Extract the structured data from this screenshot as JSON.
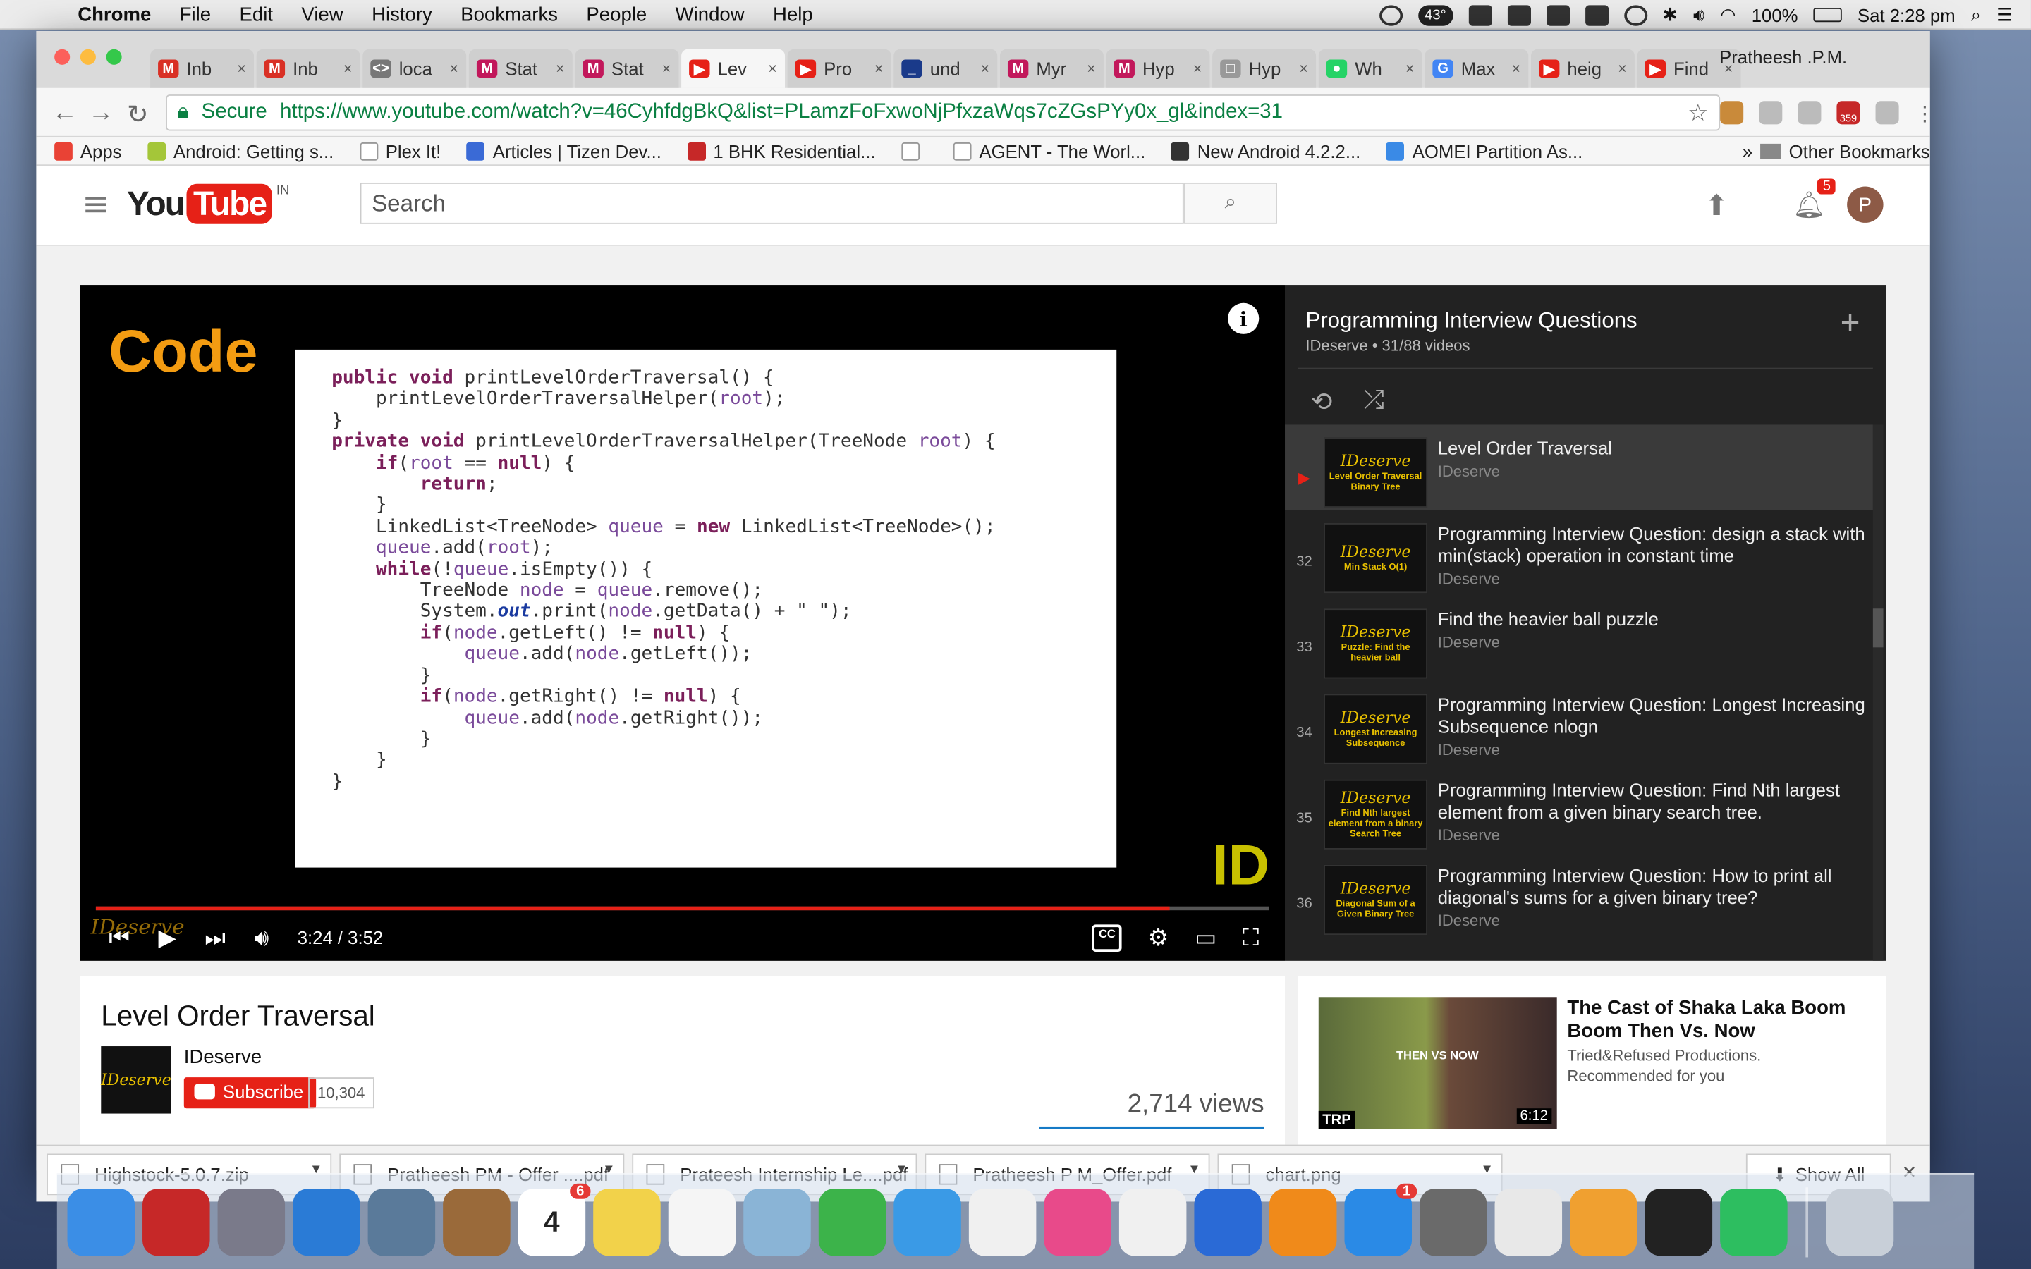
{
  "menubar": {
    "app": "Chrome",
    "items": [
      "File",
      "Edit",
      "View",
      "History",
      "Bookmarks",
      "People",
      "Window",
      "Help"
    ],
    "temperature": "43°",
    "battery": "100%",
    "clock": "Sat 2:28 pm"
  },
  "chrome": {
    "tabs": [
      {
        "label": "Inb",
        "fav": "M",
        "color": "#d93025"
      },
      {
        "label": "Inb",
        "fav": "M",
        "color": "#d93025"
      },
      {
        "label": "loca",
        "fav": "<>",
        "color": "#777777"
      },
      {
        "label": "Stat",
        "fav": "M",
        "color": "#c2185b"
      },
      {
        "label": "Stat",
        "fav": "M",
        "color": "#c2185b"
      },
      {
        "label": "Lev",
        "fav": "▶",
        "color": "#e62117"
      },
      {
        "label": "Pro",
        "fav": "▶",
        "color": "#e62117"
      },
      {
        "label": "und",
        "fav": "_",
        "color": "#1a3a8a"
      },
      {
        "label": "Myr",
        "fav": "M",
        "color": "#c2185b"
      },
      {
        "label": "Hyp",
        "fav": "M",
        "color": "#c2185b"
      },
      {
        "label": "Hyp",
        "fav": "□",
        "color": "#999999"
      },
      {
        "label": "Wh",
        "fav": "●",
        "color": "#25d366"
      },
      {
        "label": "Max",
        "fav": "G",
        "color": "#4285f4"
      },
      {
        "label": "heig",
        "fav": "▶",
        "color": "#e62117"
      },
      {
        "label": "Find",
        "fav": "▶",
        "color": "#e62117"
      }
    ],
    "active_tab": 5,
    "profile_name": "Pratheesh .P.M.",
    "secure_label": "Secure",
    "url": "https://www.youtube.com/watch?v=46CyhfdgBkQ&list=PLamzFoFxwoNjPfxzaWqs7cZGsPYy0x_gl&index=31",
    "bookmarks": [
      "Apps",
      "Android: Getting s...",
      "Plex It!",
      "Articles | Tizen Dev...",
      "1 BHK Residential...",
      "",
      "AGENT - The Worl...",
      "New Android 4.2.2...",
      "AOMEI Partition As..."
    ],
    "other_bookmarks": "Other Bookmarks",
    "ext_badge": "359"
  },
  "youtube": {
    "logo_you": "You",
    "logo_tube": "Tube",
    "logo_region": "IN",
    "search_placeholder": "Search",
    "notif_count": "5",
    "avatar_letter": "P",
    "player": {
      "overlay_label": "Code",
      "watermark_logo": "ID",
      "time": "3:24 / 3:52",
      "progress": 0.9152,
      "code_lines": [
        "public void printLevelOrderTraversal() {",
        "    printLevelOrderTraversalHelper(root);",
        "}",
        "",
        "private void printLevelOrderTraversalHelper(TreeNode root) {",
        "    if(root == null) {",
        "        return;",
        "    }",
        "",
        "    LinkedList<TreeNode> queue = new LinkedList<TreeNode>();",
        "    queue.add(root);",
        "",
        "    while(!queue.isEmpty()) {",
        "        TreeNode node = queue.remove();",
        "        System.out.print(node.getData() + \" \");",
        "        if(node.getLeft() != null) {",
        "            queue.add(node.getLeft());",
        "        }",
        "        if(node.getRight() != null) {",
        "            queue.add(node.getRight());",
        "        }",
        "    }",
        "}"
      ]
    },
    "playlist": {
      "title": "Programming Interview Questions",
      "subtitle": "IDeserve • 31/88 videos",
      "items": [
        {
          "idx": "▶",
          "title": "Level Order Traversal",
          "channel": "IDeserve",
          "thumb_text": "Level Order Traversal Binary Tree"
        },
        {
          "idx": "32",
          "title": "Programming Interview Question: design a stack with min(stack) operation in constant time",
          "channel": "IDeserve",
          "thumb_text": "Min Stack O(1)"
        },
        {
          "idx": "33",
          "title": "Find the heavier ball puzzle",
          "channel": "IDeserve",
          "thumb_text": "Puzzle: Find the heavier ball"
        },
        {
          "idx": "34",
          "title": "Programming Interview Question: Longest Increasing Subsequence nlogn",
          "channel": "IDeserve",
          "thumb_text": "Longest Increasing Subsequence"
        },
        {
          "idx": "35",
          "title": "Programming Interview Question: Find Nth largest element from a given binary search tree.",
          "channel": "IDeserve",
          "thumb_text": "Find Nth largest element from a binary Search Tree"
        },
        {
          "idx": "36",
          "title": "Programming Interview Question: How to print all diagonal's sums for a given binary tree?",
          "channel": "IDeserve",
          "thumb_text": "Diagonal Sum of a Given Binary Tree"
        }
      ],
      "thumb_brand": "IDeserve"
    },
    "video": {
      "title": "Level Order Traversal",
      "channel": "IDeserve",
      "subscribe_label": "Subscribe",
      "subscriber_count": "10,304",
      "views": "2,714 views"
    },
    "recommendation": {
      "title": "The Cast of Shaka Laka Boom Boom Then Vs. Now",
      "channel": "Tried&Refused Productions.",
      "note": "Recommended for you",
      "duration": "6:12",
      "badge": "TRP",
      "overlay": "THEN VS NOW"
    }
  },
  "downloads": {
    "files": [
      "Highstock-5.0.7.zip",
      "Pratheesh PM - Offer ....pdf",
      "Prateesh Internship Le....pdf",
      "Pratheesh P M_Offer.pdf",
      "chart.png"
    ],
    "show_all": "Show All"
  },
  "dock": {
    "apps": [
      {
        "name": "finder",
        "color": "#3b8ee6"
      },
      {
        "name": "shield",
        "color": "#c62828"
      },
      {
        "name": "launchpad",
        "color": "#7a7a8a"
      },
      {
        "name": "safari",
        "color": "#2a7bd6"
      },
      {
        "name": "eagle",
        "color": "#5a7a9a"
      },
      {
        "name": "contacts",
        "color": "#9a6a3a"
      },
      {
        "name": "calendar",
        "color": "#ffffff",
        "badge": "6",
        "label": "4"
      },
      {
        "name": "notes",
        "color": "#f2d24a"
      },
      {
        "name": "reminders",
        "color": "#f5f5f5"
      },
      {
        "name": "maps",
        "color": "#8ab4d6"
      },
      {
        "name": "facetime",
        "color": "#3cb34a"
      },
      {
        "name": "messages",
        "color": "#3a9ae6"
      },
      {
        "name": "photos",
        "color": "#f0f0f0"
      },
      {
        "name": "itunes",
        "color": "#e84a8a"
      },
      {
        "name": "numbers",
        "color": "#f0f0f0"
      },
      {
        "name": "keynote",
        "color": "#2a6ad6"
      },
      {
        "name": "ibooks",
        "color": "#f08a1a"
      },
      {
        "name": "appstore",
        "color": "#2a8ae6",
        "badge": "1"
      },
      {
        "name": "preferences",
        "color": "#6a6a6a"
      },
      {
        "name": "chrome",
        "color": "#e8e8e8"
      },
      {
        "name": "pages",
        "color": "#f0a030"
      },
      {
        "name": "terminal",
        "color": "#222222"
      },
      {
        "name": "evernote",
        "color": "#2dbe60"
      },
      {
        "name": "trash",
        "color": "#c8cfd8"
      }
    ]
  }
}
